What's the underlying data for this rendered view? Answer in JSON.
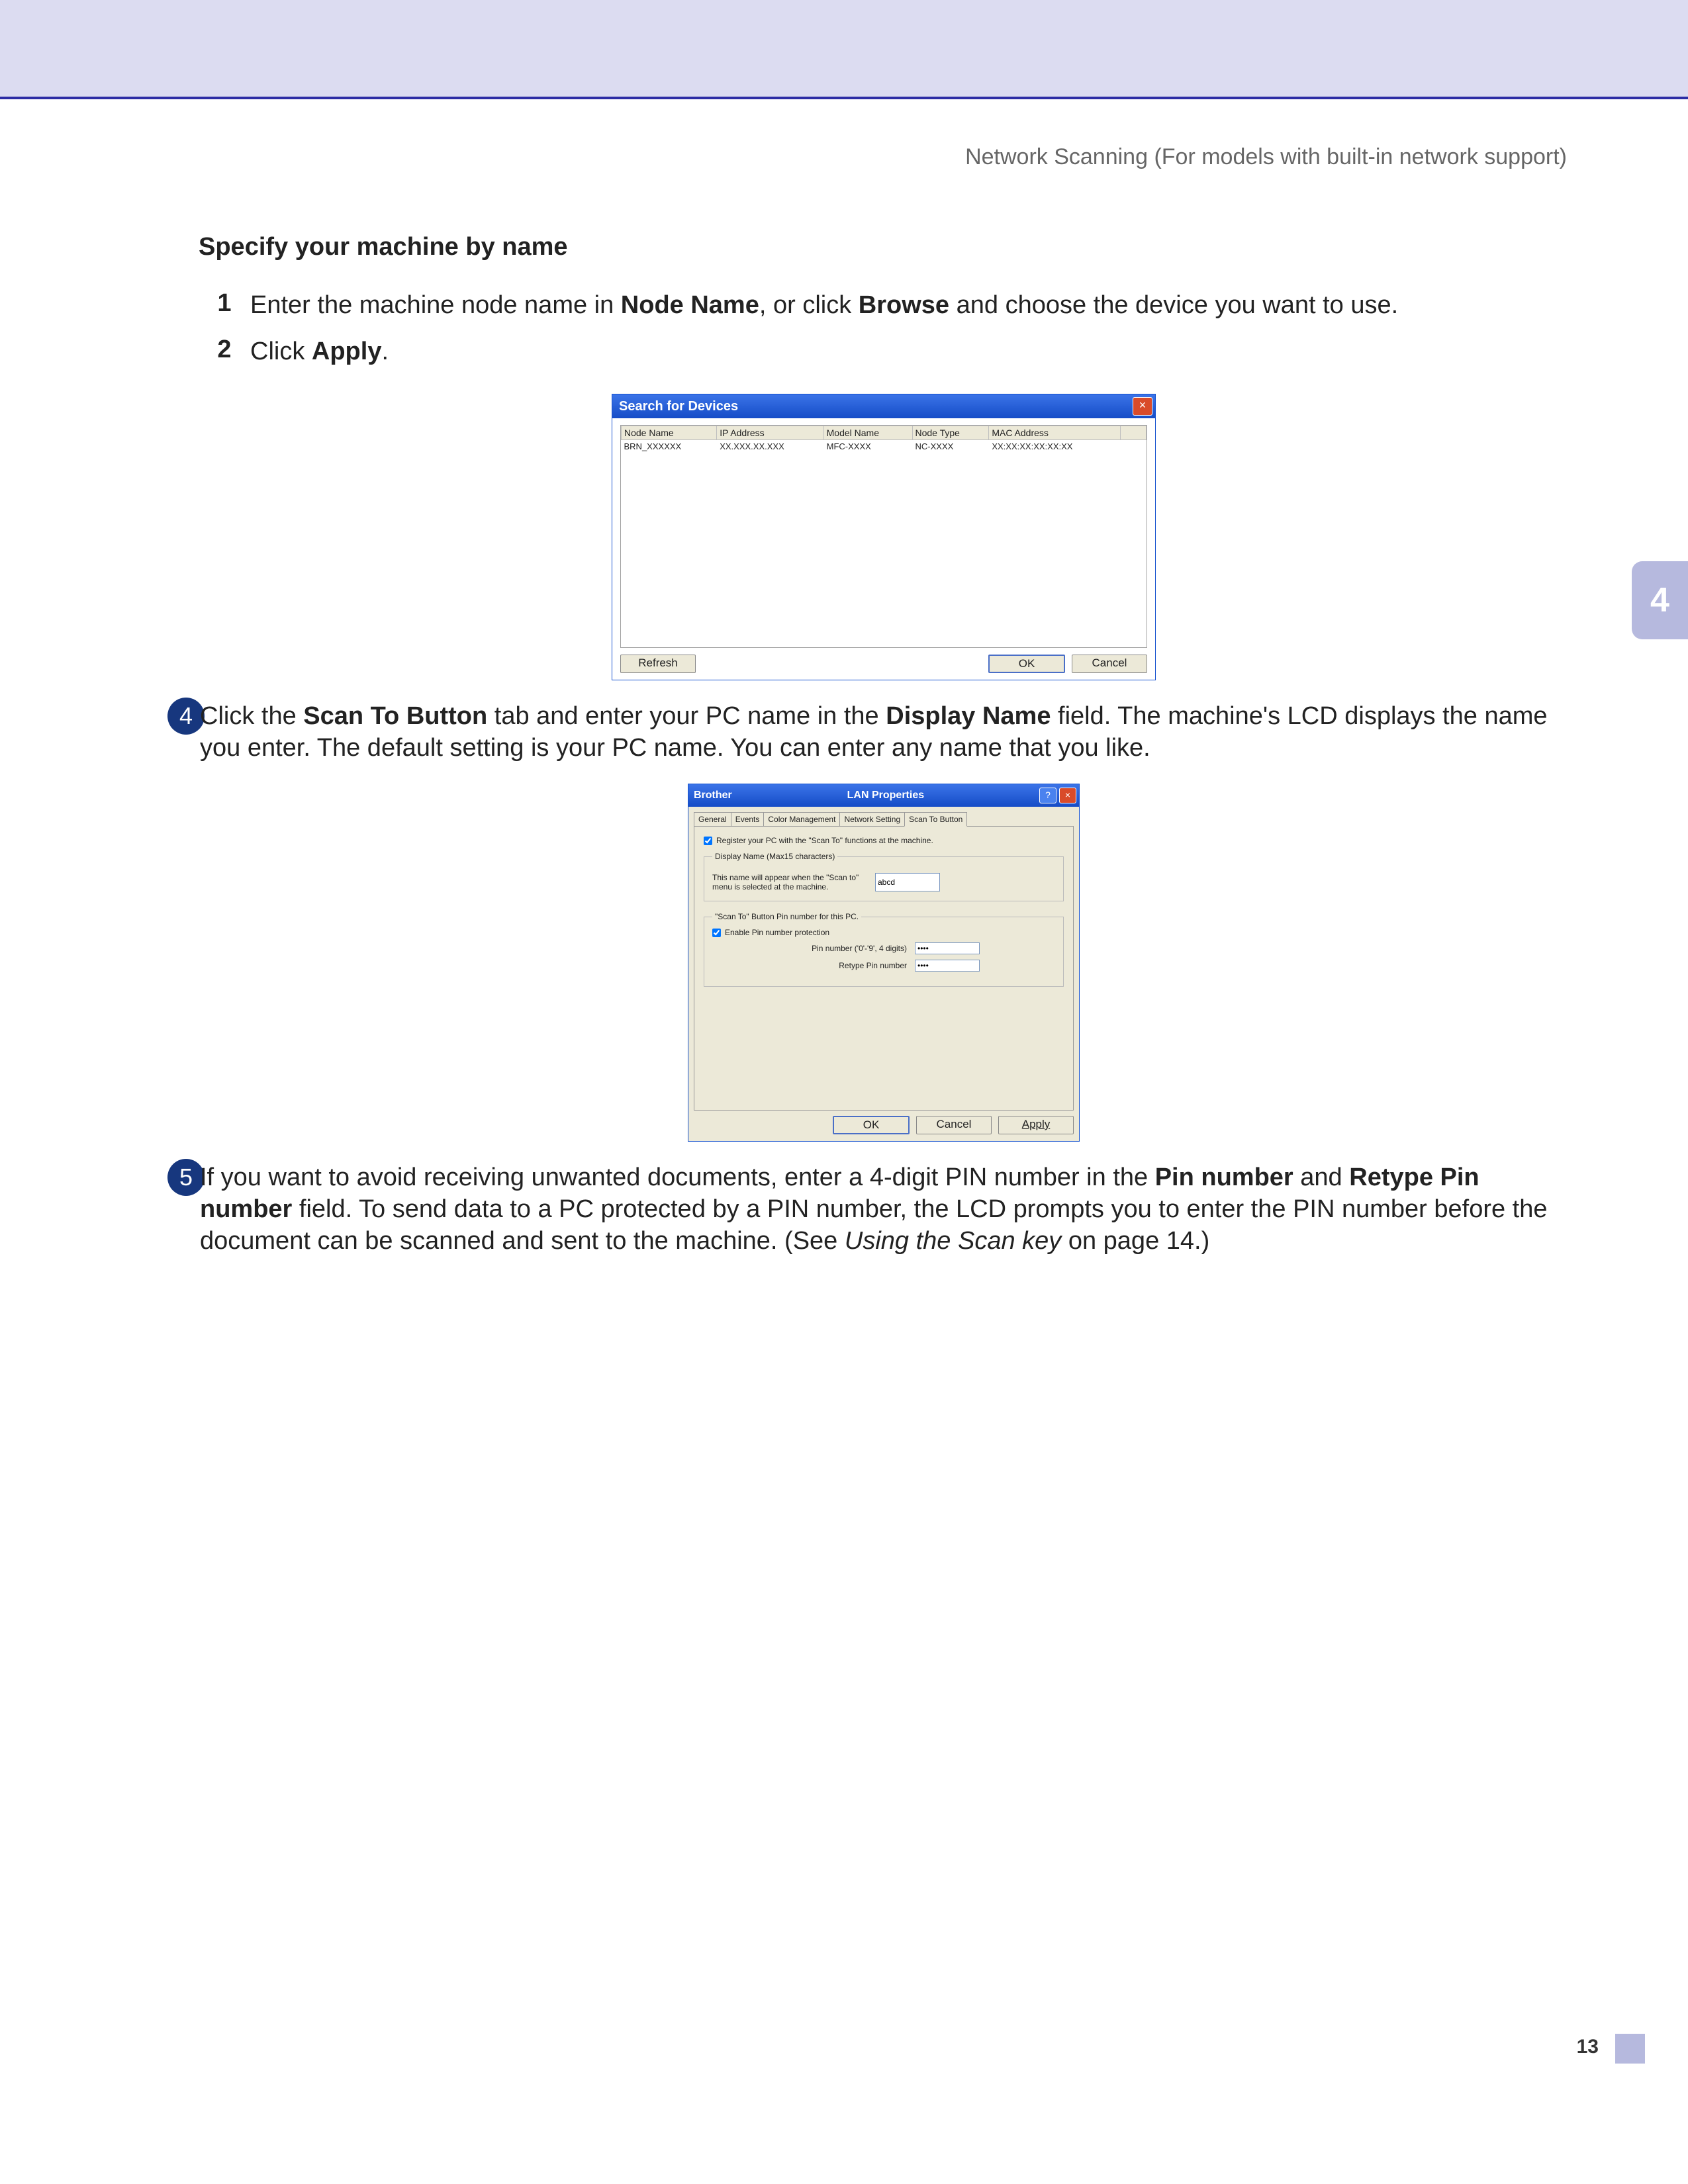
{
  "header": {
    "breadcrumb": "Network Scanning (For models with built-in network support)"
  },
  "section": {
    "title": "Specify your machine by name"
  },
  "steps": {
    "s1_num": "1",
    "s1_a": "Enter the machine node name in ",
    "s1_b": "Node Name",
    "s1_c": ", or click ",
    "s1_d": "Browse",
    "s1_e": " and choose the device you want to use.",
    "s2_num": "2",
    "s2_a": "Click ",
    "s2_b": "Apply",
    "s2_c": "."
  },
  "win1": {
    "title": "Search for Devices",
    "cols": {
      "c1": "Node Name",
      "c2": "IP Address",
      "c3": "Model Name",
      "c4": "Node Type",
      "c5": "MAC Address"
    },
    "row": {
      "c1": "BRN_XXXXXX",
      "c2": "XX.XXX.XX.XXX",
      "c3": "MFC-XXXX",
      "c4": "NC-XXXX",
      "c5": "XX:XX:XX:XX:XX:XX"
    },
    "refresh": "Refresh",
    "ok": "OK",
    "cancel": "Cancel"
  },
  "bullet4": {
    "num": "4",
    "a": "Click the ",
    "b": "Scan To Button",
    "c": " tab and enter your PC name in the ",
    "d": "Display Name",
    "e": " field. The machine's LCD displays the name you enter. The default setting is your PC name. You can enter any name that you like."
  },
  "win2": {
    "brand": "Brother",
    "title": "LAN Properties",
    "tabs": {
      "t1": "General",
      "t2": "Events",
      "t3": "Color Management",
      "t4": "Network Setting",
      "t5": "Scan To Button"
    },
    "register_chk": "Register your PC with the \"Scan To\" functions at the machine.",
    "fs1": {
      "legend": "Display Name (Max15 characters)",
      "note": "This name will appear when the \"Scan to\" menu is selected at the machine.",
      "value": "abcd"
    },
    "fs2": {
      "legend": "\"Scan To\" Button Pin number for this PC.",
      "enable": "Enable Pin number protection",
      "pin_label": "Pin number ('0'-'9', 4 digits)",
      "retype_label": "Retype Pin number",
      "masked": "••••"
    },
    "ok": "OK",
    "cancel": "Cancel",
    "apply": "Apply"
  },
  "bullet5": {
    "num": "5",
    "a": "If you want to avoid receiving unwanted documents, enter a 4-digit PIN number in the ",
    "b": "Pin number",
    "c": " and ",
    "d": "Retype Pin number",
    "e": " field. To send data to a PC protected by a PIN number, the LCD prompts you to enter the PIN number before the document can be scanned and sent to the machine. (See ",
    "f": "Using the Scan key",
    "g": " on page 14.)"
  },
  "sidetab": "4",
  "pagenum": "13"
}
